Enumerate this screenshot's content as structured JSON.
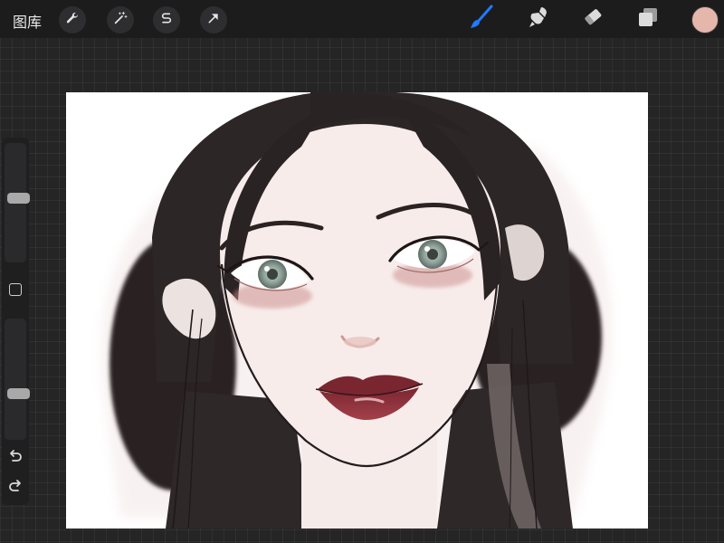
{
  "top_bar": {
    "gallery_label": "图库",
    "left_tools": [
      {
        "name": "actions",
        "icon": "wrench-icon"
      },
      {
        "name": "adjustments",
        "icon": "magic-wand-icon"
      },
      {
        "name": "selection",
        "icon": "selection-s-icon"
      },
      {
        "name": "transform",
        "icon": "arrow-cursor-icon"
      }
    ],
    "right_tools": [
      {
        "name": "brush",
        "icon": "brush-icon",
        "active": true,
        "color": "#1f7bff"
      },
      {
        "name": "smudge",
        "icon": "smudge-icon"
      },
      {
        "name": "eraser",
        "icon": "eraser-icon"
      },
      {
        "name": "layers",
        "icon": "layers-icon"
      }
    ],
    "current_color": "#e5b7ab"
  },
  "sidebar": {
    "brush_size": 0.54,
    "opacity": 0.37,
    "modifier_icon": "square-icon",
    "undo_icon": "undo-icon",
    "redo_icon": "redo-icon"
  },
  "canvas": {
    "subject": "portrait-illustration",
    "colors": {
      "background": "#ffffff",
      "skin": "#f7ecea",
      "hair": "#2a2323",
      "lips": "#8a2f36",
      "eyes": "#8fa39a"
    }
  }
}
